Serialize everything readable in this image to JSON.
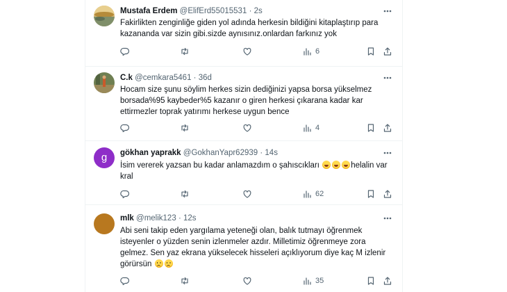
{
  "tweets": [
    {
      "name": "Mustafa Erdem",
      "handle": "@ElifErd55015531",
      "dot": "·",
      "time": "2s",
      "lines": [
        "Fakirlikten zenginliğe giden yol adında herkesin bildiğini kitaplaştırıp para",
        "kazananda var sizin gibi.sizde aynısınız.onlardan farkınız yok"
      ],
      "views": "6",
      "avatar": {
        "kind": "photo-sunset",
        "colors": [
          "#c9a24a",
          "#6f8a6b"
        ]
      }
    },
    {
      "name": "C.k",
      "handle": "@cemkara5461",
      "dot": "·",
      "time": "36d",
      "lines": [
        "Hocam size şunu söylim herkes sizin dediğinizi yapsa borsa yükselmez",
        "borsada%95 kaybeder%5 kazanır o giren herkesi çıkarana kadar kar",
        "ettirmezler toprak yatırımı herkese uygun bence"
      ],
      "views": "4",
      "avatar": {
        "kind": "photo-figure",
        "colors": [
          "#7a8a55",
          "#c7a25a"
        ]
      }
    },
    {
      "name": "gökhan yaprakk",
      "handle": "@GokhanYapr62939",
      "dot": "·",
      "time": "14s",
      "line1_text": "İsim vererek yazsan bu kadar anlamazdım o şahıscıkları ",
      "line1_after": "helalin var",
      "line2": "kral",
      "emoji_line1": [
        "rolling-on-floor-laughing-emoji",
        "rolling-on-floor-laughing-emoji",
        "rolling-on-floor-laughing-emoji"
      ],
      "views": "62",
      "avatar": {
        "kind": "letter",
        "letter": "g",
        "color": "#8e2dc8"
      }
    },
    {
      "name": "mlk",
      "handle": "@melik123",
      "dot": "·",
      "time": "12s",
      "lines": [
        "Abi seni takip eden yargılama yeteneği olan, balık tutmayı öğrenmek",
        "isteyenler o yüzden senin izlenmeler azdır. Milletimiz öğrenmeye zora",
        "gelmez. Sen yaz ekrana yükselecek hisseleri açıklıyorum diye kaç M izlenir"
      ],
      "last_line": "görürsün ",
      "emoji_last": [
        "pleading-face-emoji",
        "pleading-face-emoji"
      ],
      "views": "35",
      "avatar": {
        "kind": "plain",
        "color": "#b8781f"
      }
    }
  ],
  "icons": {
    "more": "more-horizontal-icon",
    "reply": "reply-icon",
    "retweet": "retweet-icon",
    "like": "heart-icon",
    "views": "views-bar-chart-icon",
    "bookmark": "bookmark-icon",
    "share": "share-icon"
  },
  "colors": {
    "text": "#0f1419",
    "secondary": "#536471",
    "border": "#eff3f4"
  }
}
